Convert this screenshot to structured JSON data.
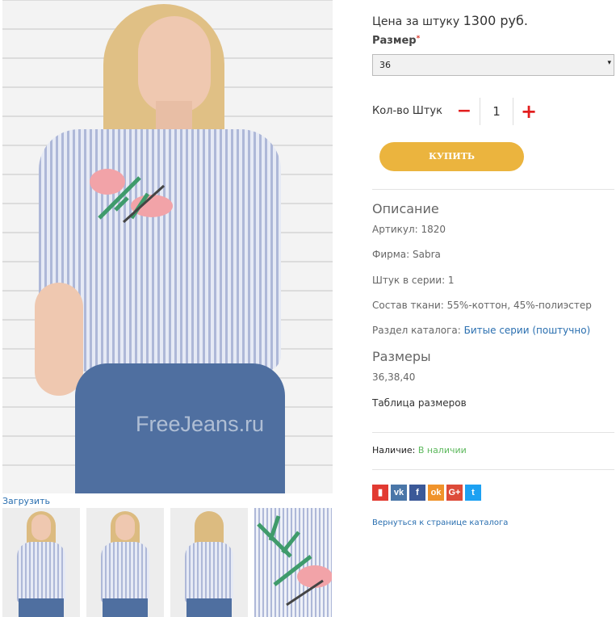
{
  "photo": {
    "watermark": "FreeJeans.ru"
  },
  "gallery": {
    "upload_label": "Загрузить"
  },
  "product": {
    "price_prefix": "Цена за штуку",
    "price_value": "1300 руб.",
    "size_label": "Размер",
    "size_required_mark": "*",
    "size_selected": "36",
    "qty_label": "Кол-во Штук",
    "qty_value": "1",
    "buy_label": "КУПИТЬ"
  },
  "description": {
    "heading": "Описание",
    "article": "Артикул: 1820",
    "brand": "Фирма: Sabra",
    "pieces": "Штук в серии: 1",
    "fabric": "Состав ткани: 55%-коттон, 45%-полиэстер",
    "catalog_prefix": "Раздел каталога:",
    "catalog_link": "Битые серии (поштучно)"
  },
  "sizes": {
    "heading": "Размеры",
    "list": "36,38,40",
    "table_link": "Таблица размеров"
  },
  "availability": {
    "label": "Наличие:",
    "value": "В наличии"
  },
  "social": [
    {
      "icon": "bookmark-icon",
      "glyph": "▮",
      "color": "#e23a31"
    },
    {
      "icon": "vk-icon",
      "glyph": "vk",
      "color": "#4a76a8"
    },
    {
      "icon": "facebook-icon",
      "glyph": "f",
      "color": "#3b5998"
    },
    {
      "icon": "odnoklassniki-icon",
      "glyph": "ok",
      "color": "#f0932b"
    },
    {
      "icon": "google-plus-icon",
      "glyph": "G+",
      "color": "#dd4b39"
    },
    {
      "icon": "twitter-icon",
      "glyph": "t",
      "color": "#1da1f2"
    }
  ],
  "back_link": "Вернуться к странице каталога"
}
